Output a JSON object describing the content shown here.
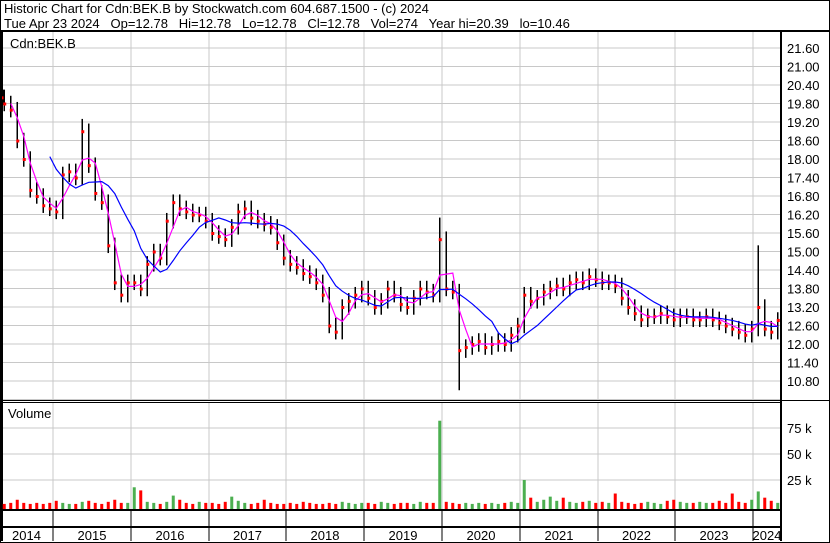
{
  "header": {
    "title": "Historic Chart for Cdn:BEK.B by Stockwatch.com 604.687.1500 - (c) 2024",
    "quote": "Tue Apr 23 2024   Op=12.78   Hi=12.78   Lo=12.78   Cl=12.78   Vol=274   Year hi=20.39   lo=10.46"
  },
  "colors": {
    "bar": "#000000",
    "close": "#ff0000",
    "ma_short": "#ff00ff",
    "ma_long": "#0000ff",
    "vol_up": "#4caf50",
    "vol_down": "#ff0000",
    "grid": "#c8c8c8"
  },
  "chart_data": {
    "type": "line",
    "symbol_label": "Cdn:BEK.B",
    "volume_label": "Volume",
    "start_month": "2014-04",
    "price_ticks": [
      "21.60",
      "21.00",
      "20.40",
      "19.80",
      "19.20",
      "18.60",
      "18.00",
      "17.40",
      "16.80",
      "16.20",
      "15.60",
      "15.00",
      "14.40",
      "13.80",
      "13.20",
      "12.60",
      "12.00",
      "11.40",
      "10.80"
    ],
    "price_range": [
      10.8,
      21.6
    ],
    "volume_ticks": [
      "75 k",
      "50 k",
      "25 k"
    ],
    "volume_range_k": [
      0,
      100
    ],
    "years": [
      "2014",
      "2015",
      "2016",
      "2017",
      "2018",
      "2019",
      "2020",
      "2021",
      "2022",
      "2023",
      "2024"
    ],
    "close": [
      20.0,
      19.8,
      19.6,
      18.6,
      18.0,
      17.0,
      16.8,
      16.5,
      16.4,
      16.3,
      17.5,
      17.6,
      17.4,
      18.9,
      17.8,
      16.9,
      16.6,
      15.2,
      14.0,
      13.6,
      14.0,
      14.0,
      13.8,
      14.6,
      15.0,
      14.8,
      16.0,
      16.6,
      16.4,
      16.3,
      16.2,
      16.2,
      16.0,
      15.6,
      15.5,
      15.4,
      15.8,
      16.3,
      16.4,
      16.1,
      16.0,
      15.9,
      15.8,
      15.3,
      14.8,
      14.6,
      14.5,
      14.3,
      14.2,
      14.0,
      13.6,
      12.6,
      12.4,
      13.2,
      13.4,
      13.6,
      13.8,
      13.5,
      13.2,
      13.4,
      13.8,
      13.6,
      13.3,
      13.2,
      13.5,
      13.8,
      13.7,
      13.6,
      15.4,
      13.8,
      13.7,
      11.8,
      11.9,
      12.0,
      12.1,
      11.9,
      12.0,
      12.1,
      12.0,
      12.3,
      12.6,
      13.6,
      13.4,
      13.5,
      13.7,
      13.8,
      13.9,
      13.8,
      14.0,
      14.1,
      14.0,
      14.2,
      14.1,
      14.0,
      14.0,
      13.9,
      13.5,
      13.2,
      13.0,
      12.8,
      12.9,
      12.9,
      13.0,
      12.9,
      12.8,
      12.9,
      12.9,
      12.8,
      12.8,
      12.9,
      12.8,
      12.7,
      12.6,
      12.5,
      12.4,
      12.3,
      12.5,
      13.2,
      12.5,
      12.4,
      12.78
    ],
    "spikes": [
      {
        "index": 13,
        "high": 19.3
      },
      {
        "index": 68,
        "high": 16.1
      },
      {
        "index": 71,
        "low": 10.5
      },
      {
        "index": 117,
        "high": 15.2
      }
    ],
    "volume_k": [
      3,
      2,
      3,
      6,
      3,
      2,
      3,
      2,
      3,
      5,
      3,
      2,
      2,
      4,
      5,
      3,
      2,
      4,
      6,
      3,
      3,
      18,
      15,
      4,
      3,
      2,
      4,
      10,
      6,
      3,
      2,
      4,
      3,
      3,
      2,
      4,
      9,
      5,
      3,
      2,
      3,
      6,
      3,
      2,
      2,
      3,
      2,
      4,
      3,
      2,
      2,
      3,
      2,
      4,
      3,
      2,
      3,
      3,
      2,
      4,
      3,
      2,
      3,
      3,
      2,
      4,
      3,
      3,
      82,
      4,
      3,
      2,
      3,
      2,
      3,
      2,
      3,
      2,
      3,
      4,
      3,
      25,
      8,
      4,
      6,
      9,
      5,
      8,
      4,
      3,
      4,
      5,
      3,
      4,
      3,
      12,
      4,
      3,
      2,
      3,
      4,
      3,
      2,
      5,
      6,
      4,
      3,
      3,
      4,
      3,
      3,
      5,
      3,
      12,
      4,
      3,
      6,
      14,
      8,
      5,
      3
    ],
    "ma_short_months": 3,
    "ma_long_months": 9
  }
}
